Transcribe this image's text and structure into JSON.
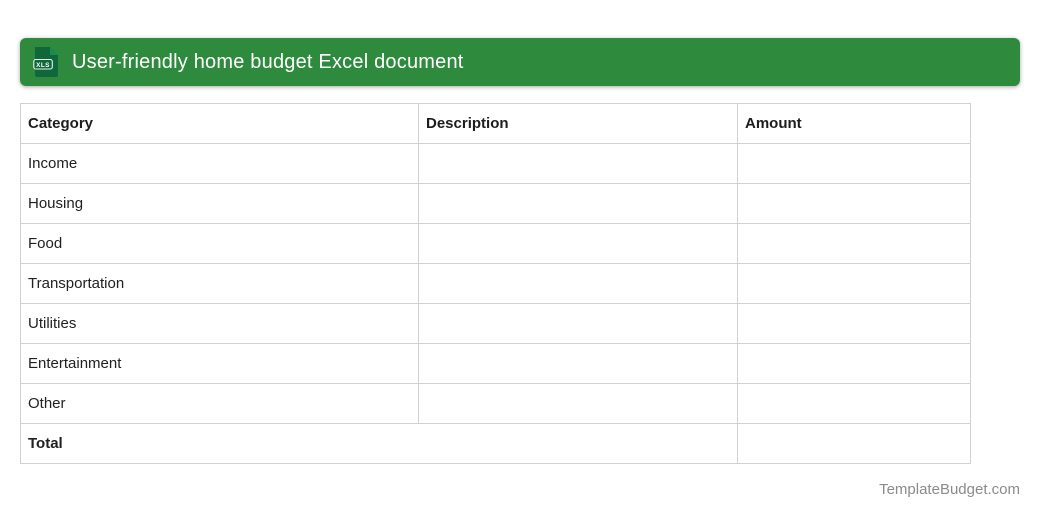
{
  "banner": {
    "title": "User-friendly home budget Excel document",
    "icon_label": "XLS"
  },
  "colors": {
    "banner_green": "#2e8b3d",
    "icon_document_green": "#10683a",
    "icon_fold_green": "#1c8c4e",
    "table_border": "#d0d0d0",
    "text_dark": "#212121",
    "footer_gray": "#8b8b8b"
  },
  "table": {
    "columns": [
      "Category",
      "Description",
      "Amount"
    ],
    "rows": [
      {
        "category": "Income",
        "description": "",
        "amount": ""
      },
      {
        "category": "Housing",
        "description": "",
        "amount": ""
      },
      {
        "category": "Food",
        "description": "",
        "amount": ""
      },
      {
        "category": "Transportation",
        "description": "",
        "amount": ""
      },
      {
        "category": "Utilities",
        "description": "",
        "amount": ""
      },
      {
        "category": "Entertainment",
        "description": "",
        "amount": ""
      },
      {
        "category": "Other",
        "description": "",
        "amount": ""
      }
    ],
    "total": {
      "label": "Total",
      "amount": ""
    }
  },
  "footer": {
    "site": "TemplateBudget.com"
  }
}
